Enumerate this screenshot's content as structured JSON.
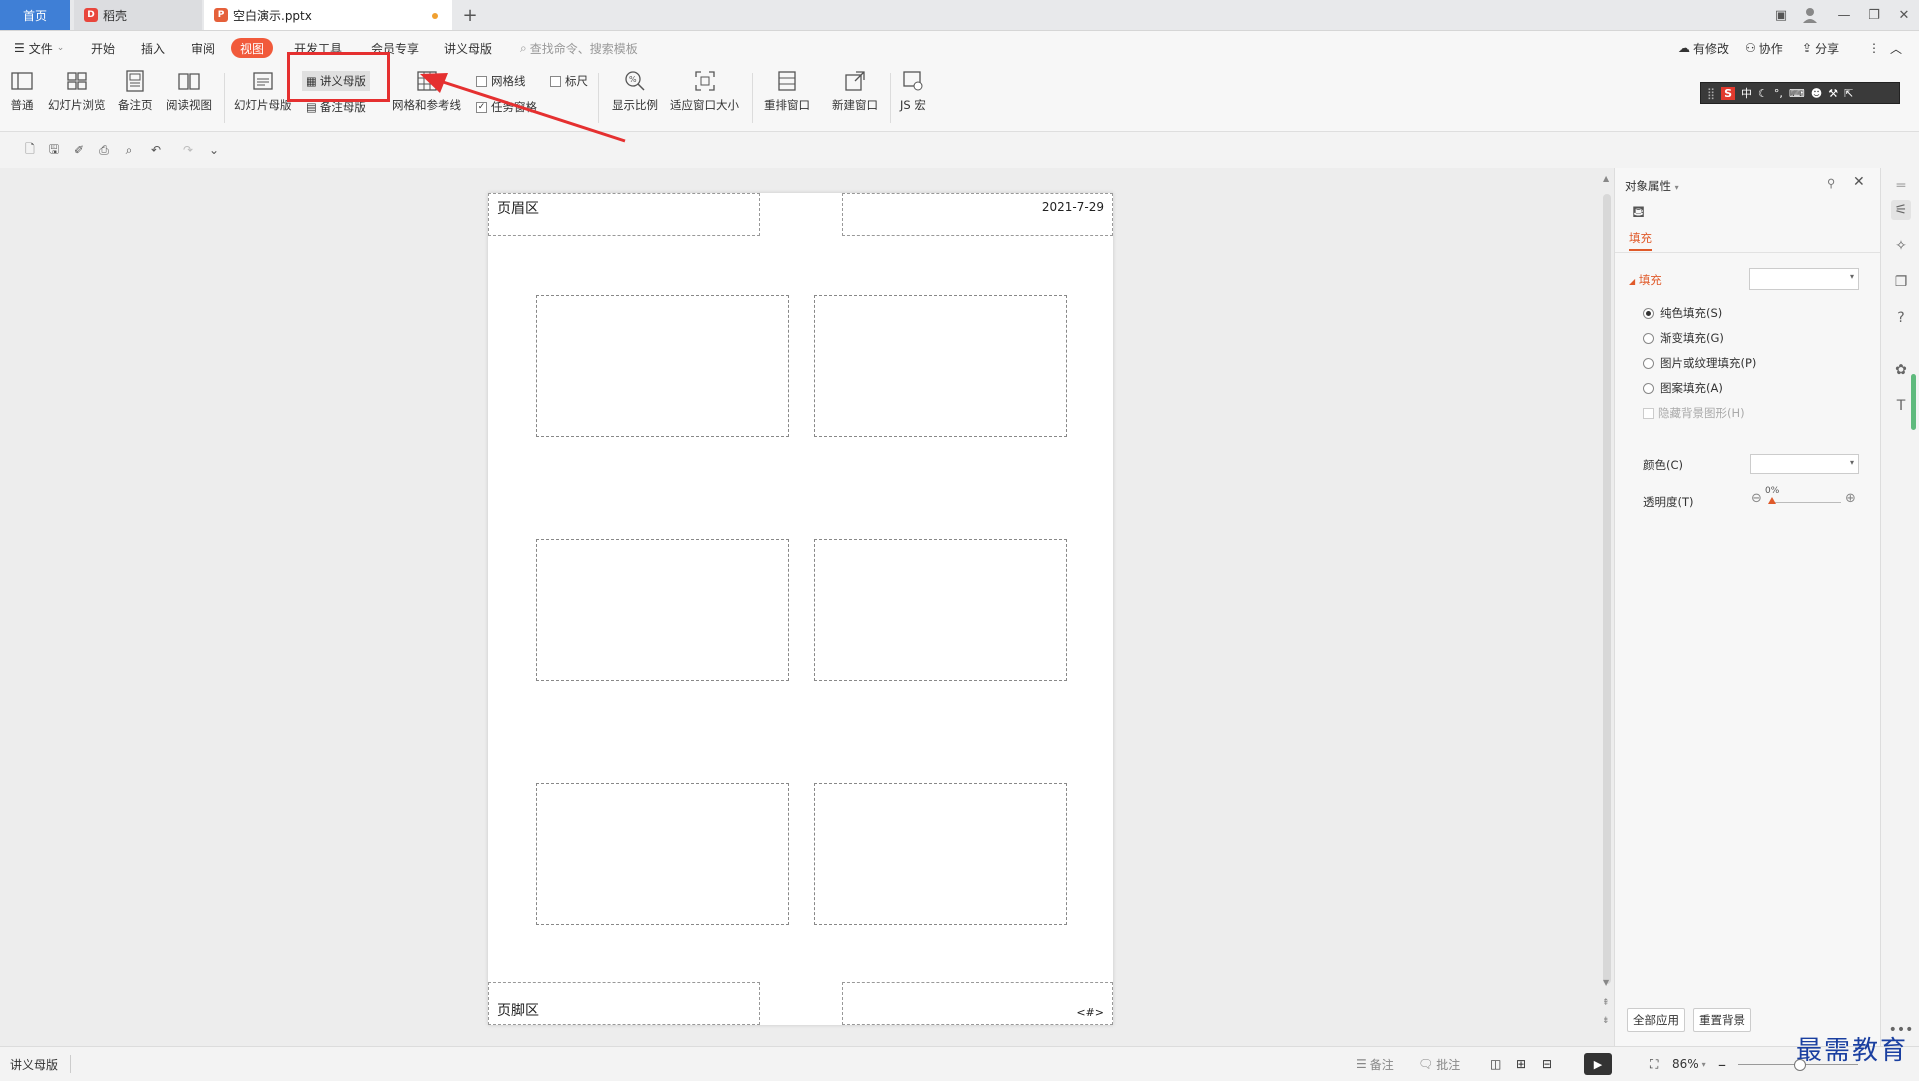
{
  "tabs": {
    "home": "首页",
    "daoke": "稻壳",
    "document": "空白演示.pptx"
  },
  "menu": {
    "file": "文件",
    "items": [
      "开始",
      "插入",
      "审阅",
      "视图",
      "开发工具",
      "会员专享",
      "讲义母版"
    ],
    "active": "视图",
    "search_placeholder": "查找命令、搜索模板",
    "right": [
      "有修改",
      "协作",
      "分享"
    ]
  },
  "ribbon": {
    "normal": "普通",
    "slide_browse": "幻灯片浏览",
    "notes_page": "备注页",
    "reading_view": "阅读视图",
    "slide_master": "幻灯片母版",
    "handout_master": "讲义母版",
    "notes_master": "备注母版",
    "grid_guides": "网格和参考线",
    "gridlines": "网格线",
    "ruler": "标尺",
    "task_pane": "任务窗格",
    "zoom": "显示比例",
    "fit_window": "适应窗口大小",
    "arrange": "重排窗口",
    "new_window": "新建窗口",
    "js_macro": "JS 宏"
  },
  "ime": {
    "lang": "中"
  },
  "page": {
    "header": "页眉区",
    "date": "2021-7-29",
    "footer": "页脚区",
    "page_num": "<#>"
  },
  "panel": {
    "title": "对象属性",
    "tab_fill": "填充",
    "section_fill": "填充",
    "options": [
      "纯色填充(S)",
      "渐变填充(G)",
      "图片或纹理填充(P)",
      "图案填充(A)"
    ],
    "selected_option": "纯色填充(S)",
    "hide_bg": "隐藏背景图形(H)",
    "color_label": "颜色(C)",
    "transparency_label": "透明度(T)",
    "transparency_value": "0%",
    "apply_all": "全部应用",
    "reset_bg": "重置背景"
  },
  "status": {
    "mode": "讲义母版",
    "notes": "备注",
    "comments": "批注",
    "zoom": "86%"
  },
  "watermark": "最需教育"
}
